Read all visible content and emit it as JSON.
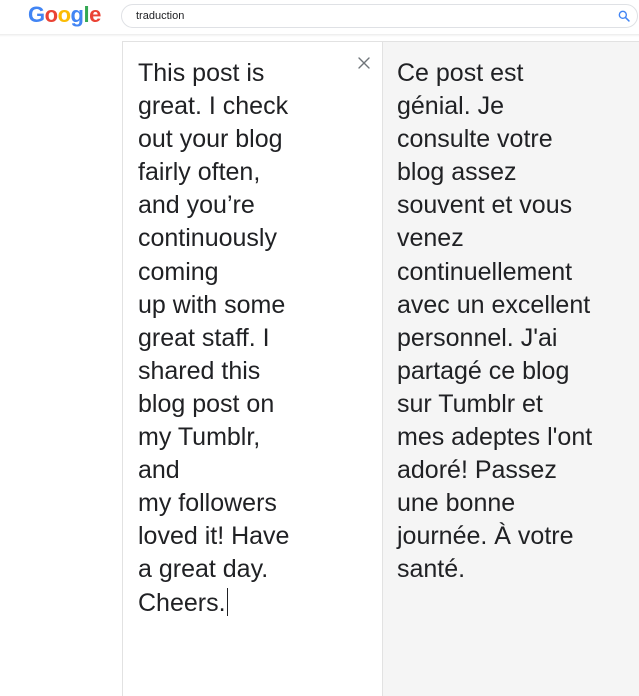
{
  "header": {
    "logo_letters": [
      {
        "char": "G",
        "color": "#4285F4"
      },
      {
        "char": "o",
        "color": "#EA4335"
      },
      {
        "char": "o",
        "color": "#FBBC05"
      },
      {
        "char": "g",
        "color": "#4285F4"
      },
      {
        "char": "l",
        "color": "#34A853"
      },
      {
        "char": "e",
        "color": "#EA4335"
      }
    ],
    "search_value": "traduction",
    "search_icon": "search-icon",
    "accent_color": "#4285F4"
  },
  "translator": {
    "source_text": "This post is\ngreat. I check\nout your blog\nfairly often,\nand you’re\ncontinuously\ncoming\nup with some\ngreat staff. I\nshared this\nblog post on\nmy Tumblr,\nand\nmy followers\nloved it! Have\na great day.\nCheers.",
    "clear_icon": "close-icon",
    "translated_text": "Ce post est\ngénial. Je\nconsulte votre\nblog assez\nsouvent et vous\nvenez\ncontinuellement\navec un excellent\npersonnel. J'ai\npartagé ce blog\nsur Tumblr et\nmes adeptes l'ont\nadoré! Passez\nune bonne\njournée. À votre\nsanté."
  }
}
